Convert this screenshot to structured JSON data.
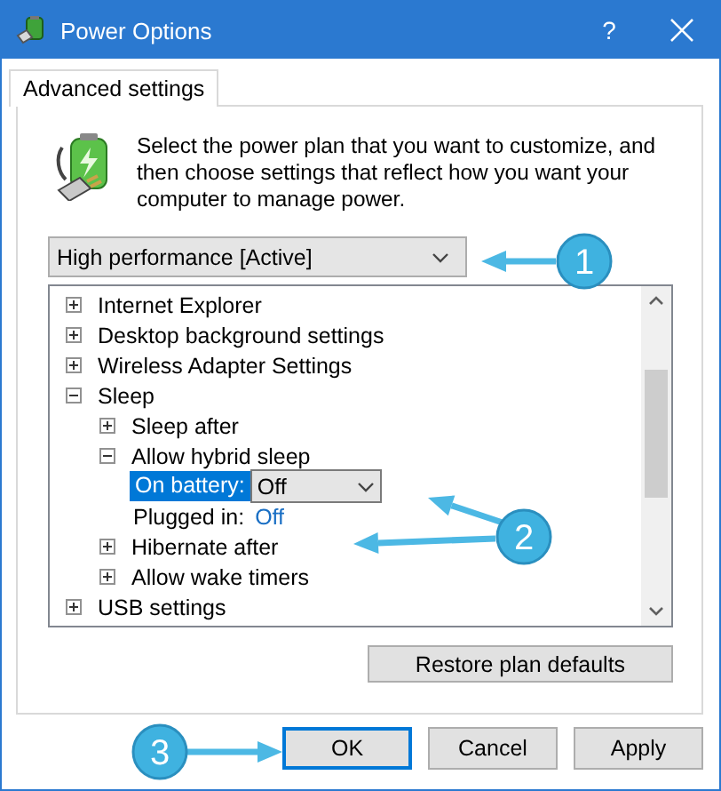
{
  "window": {
    "title": "Power Options",
    "help": "?"
  },
  "tabs": [
    {
      "label": "Advanced settings",
      "selected": true
    }
  ],
  "description": "Select the power plan that you want to customize, and then choose settings that reflect how you want your computer to manage power.",
  "plan_dropdown": {
    "value": "High performance [Active]"
  },
  "settings_tree": [
    {
      "kind": "group",
      "label": "Internet Explorer",
      "expanded": false
    },
    {
      "kind": "group",
      "label": "Desktop background settings",
      "expanded": false
    },
    {
      "kind": "group",
      "label": "Wireless Adapter Settings",
      "expanded": false
    },
    {
      "kind": "group",
      "label": "Sleep",
      "expanded": true,
      "children": [
        {
          "kind": "group",
          "label": "Sleep after",
          "expanded": false
        },
        {
          "kind": "group",
          "label": "Allow hybrid sleep",
          "expanded": true,
          "children": [
            {
              "kind": "setting",
              "label": "On battery:",
              "value": "Off",
              "selected": true
            },
            {
              "kind": "setting",
              "label": "Plugged in:",
              "value": "Off",
              "selected": false
            }
          ]
        },
        {
          "kind": "group",
          "label": "Hibernate after",
          "expanded": false
        },
        {
          "kind": "group",
          "label": "Allow wake timers",
          "expanded": false
        }
      ]
    },
    {
      "kind": "group",
      "label": "USB settings",
      "expanded": false
    }
  ],
  "restore_button": "Restore plan defaults",
  "buttons": [
    {
      "label": "OK",
      "focused": true
    },
    {
      "label": "Cancel",
      "focused": false
    },
    {
      "label": "Apply",
      "focused": false
    }
  ],
  "annotations": [
    {
      "label": "1"
    },
    {
      "label": "2"
    },
    {
      "label": "3"
    }
  ]
}
